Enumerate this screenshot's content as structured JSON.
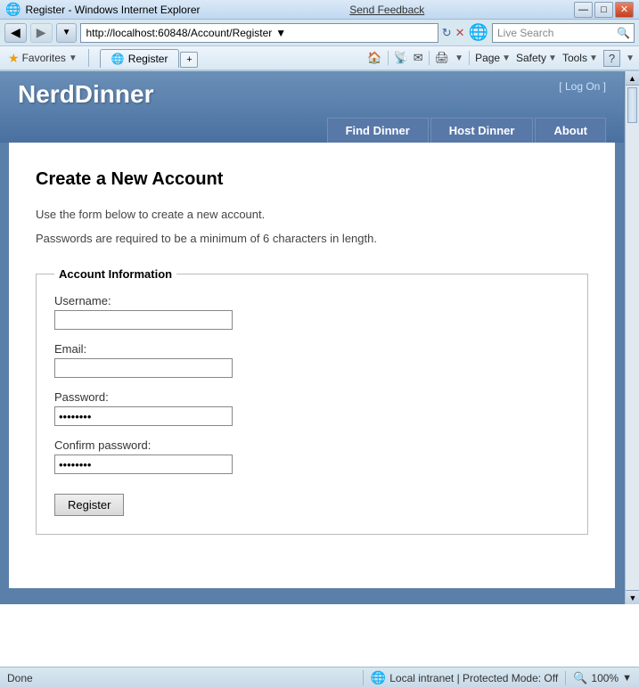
{
  "titlebar": {
    "title": "Register - Windows Internet Explorer",
    "icon": "🌐",
    "buttons": {
      "minimize": "—",
      "maximize": "□",
      "close": "✕"
    },
    "feedback": "Send Feedback"
  },
  "addressbar": {
    "url": "http://localhost:60848/Account/Register",
    "go_arrow": "→",
    "refresh": "↻",
    "stop": "✕",
    "live_search_placeholder": "Live Search"
  },
  "toolbar": {
    "favorites_label": "Favorites",
    "tab_label": "Register",
    "page_menu": "Page",
    "safety_menu": "Safety",
    "tools_menu": "Tools",
    "help_icon": "?"
  },
  "header": {
    "site_title": "NerdDinner",
    "login_text": "[ Log On ]",
    "nav": {
      "find_dinner": "Find Dinner",
      "host_dinner": "Host Dinner",
      "about": "About"
    }
  },
  "form": {
    "page_title": "Create a New Account",
    "intro": "Use the form below to create a new account.",
    "password_note": "Passwords are required to be a minimum of 6 characters in length.",
    "fieldset_legend": "Account Information",
    "fields": {
      "username_label": "Username:",
      "username_value": "",
      "email_label": "Email:",
      "email_value": "",
      "password_label": "Password:",
      "password_value": "••••••",
      "confirm_label": "Confirm password:",
      "confirm_value": "••••••"
    },
    "register_button": "Register"
  },
  "statusbar": {
    "status": "Done",
    "zone": "Local intranet | Protected Mode: Off",
    "zoom": "100%",
    "zoom_icon": "🔍"
  }
}
